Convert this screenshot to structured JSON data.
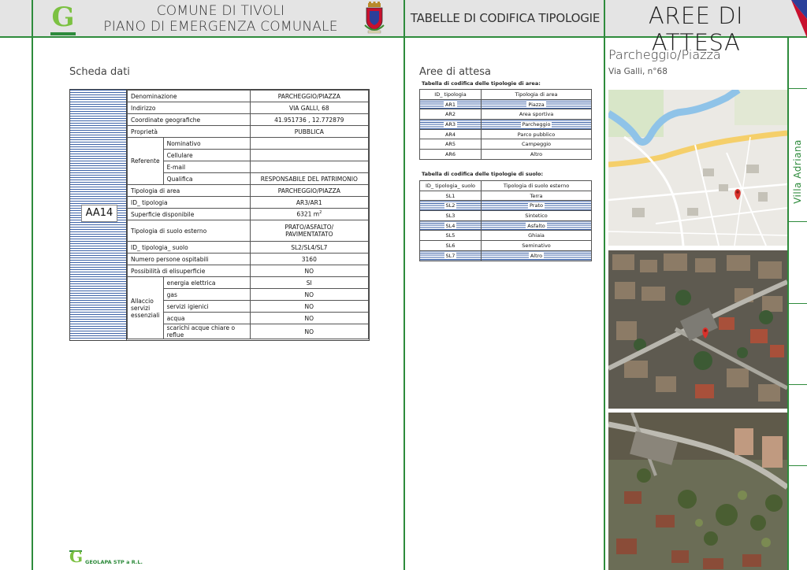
{
  "header": {
    "comune_line1": "COMUNE DI TIVOLI",
    "comune_line2": "PIANO DI EMERGENZA COMUNALE",
    "section": "TABELLE DI CODIFICA TIPOLOGIE",
    "category": "AREE DI ATTESA",
    "logo_letter": "G"
  },
  "scheda": {
    "title": "Scheda dati",
    "code": "AA14",
    "rows": {
      "denominazione_label": "Denominazione",
      "denominazione_value": "PARCHEGGIO/PIAZZA",
      "indirizzo_label": "Indirizzo",
      "indirizzo_value": "VIA GALLI, 68",
      "coordinate_label": "Coordinate geografiche",
      "coordinate_value": "41.951736 , 12.772879",
      "proprieta_label": "Proprietà",
      "proprieta_value": "PUBBLICA",
      "referente_label": "Referente",
      "nominativo_label": "Nominativo",
      "nominativo_value": "",
      "cellulare_label": "Cellulare",
      "cellulare_value": "",
      "email_label": "E-mail",
      "email_value": "",
      "qualifica_label": "Qualifica",
      "qualifica_value": "RESPONSABILE DEL PATRIMONIO",
      "tipologia_area_label": "Tipologia di area",
      "tipologia_area_value": "PARCHEGGIO/PIAZZA",
      "id_tipologia_label": "ID_ tipologia",
      "id_tipologia_value": "AR3/AR1",
      "superficie_label": "Superficie disponibile",
      "superficie_value": "6321 m",
      "superficie_unit_sup": "2",
      "tipologia_suolo_label": "Tipologia di suolo esterno",
      "tipologia_suolo_value_1": "PRATO/ASFALTO/",
      "tipologia_suolo_value_2": "PAVIMENTATATO",
      "id_suolo_label": "ID_ tipologia_ suolo",
      "id_suolo_value": "SL2/SL4/SL7",
      "persone_label": "Numero persone ospitabili",
      "persone_value": "3160",
      "elisuperficie_label": "Possibilità di elisuperficie",
      "elisuperficie_value": "NO",
      "allaccio_label_1": "Allaccio",
      "allaccio_label_2": "servizi",
      "allaccio_label_3": "essenziali",
      "services": [
        {
          "label": "energia elettrica",
          "value": "SI"
        },
        {
          "label": "gas",
          "value": "NO"
        },
        {
          "label": "servizi igienici",
          "value": "NO"
        },
        {
          "label": "acqua",
          "value": "NO"
        },
        {
          "label": "scarichi acque chiare o reflue",
          "value": "NO"
        }
      ]
    }
  },
  "codifica": {
    "title": "Aree di attesa",
    "area_caption": "Tabella di codifica delle tipologie di area:",
    "area_headers": [
      "ID_ tipologia",
      "Tipologia di area"
    ],
    "area_rows": [
      {
        "id": "AR1",
        "name": "Piazza"
      },
      {
        "id": "AR2",
        "name": "Area sportiva"
      },
      {
        "id": "AR3",
        "name": "Parcheggio"
      },
      {
        "id": "AR4",
        "name": "Parco pubblico"
      },
      {
        "id": "AR5",
        "name": "Campeggio"
      },
      {
        "id": "AR6",
        "name": "Altro"
      }
    ],
    "suolo_caption": "Tabella di codifica delle tipologie di suolo:",
    "suolo_headers": [
      "ID_ tipologia_ suolo",
      "Tipologia di suolo esterno"
    ],
    "suolo_rows": [
      {
        "id": "SL1",
        "name": "Terra"
      },
      {
        "id": "SL2",
        "name": "Prato"
      },
      {
        "id": "SL3",
        "name": "Sintetico"
      },
      {
        "id": "SL4",
        "name": "Asfalto"
      },
      {
        "id": "SL5",
        "name": "Ghiaia"
      },
      {
        "id": "SL6",
        "name": "Seminativo"
      },
      {
        "id": "SL7",
        "name": "Altro"
      }
    ]
  },
  "location": {
    "title": "Parcheggio/Piazza",
    "address": "Via Galli, n°68",
    "side_label": "Villa Adriana",
    "map_marker_color": "#d9312b"
  },
  "footer": {
    "logo_letter": "G",
    "company": "GEOLAPA STP  a R.L."
  },
  "colors": {
    "accent_green": "#2e8b3c",
    "logo_green": "#7cc142",
    "stripe_blue": "#3d63a8",
    "flag_blue": "#2b3f9a",
    "flag_red": "#c8102e"
  }
}
